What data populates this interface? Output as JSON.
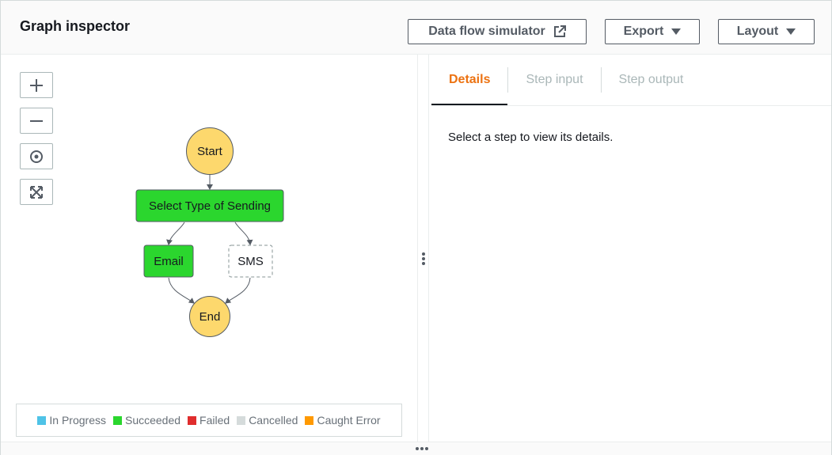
{
  "header": {
    "title": "Graph inspector",
    "data_flow_label": "Data flow simulator",
    "export_label": "Export",
    "layout_label": "Layout"
  },
  "zoom_controls": [
    "zoom-in",
    "zoom-out",
    "center",
    "fit-to-screen"
  ],
  "graph": {
    "nodes": {
      "start": "Start",
      "select": "Select Type of Sending",
      "email": "Email",
      "sms": "SMS",
      "end": "End"
    },
    "colors": {
      "terminal": "#fdd86d",
      "succeeded": "#2bd62e",
      "not_run": "#ffffff"
    }
  },
  "legend": [
    {
      "label": "In Progress",
      "color": "#4fc3e7"
    },
    {
      "label": "Succeeded",
      "color": "#2bd62e"
    },
    {
      "label": "Failed",
      "color": "#e02d2d"
    },
    {
      "label": "Cancelled",
      "color": "#d5dbdb"
    },
    {
      "label": "Caught Error",
      "color": "#ff9900"
    }
  ],
  "details": {
    "tabs": [
      {
        "label": "Details",
        "active": true
      },
      {
        "label": "Step input",
        "active": false
      },
      {
        "label": "Step output",
        "active": false
      }
    ],
    "empty_message": "Select a step to view its details."
  }
}
